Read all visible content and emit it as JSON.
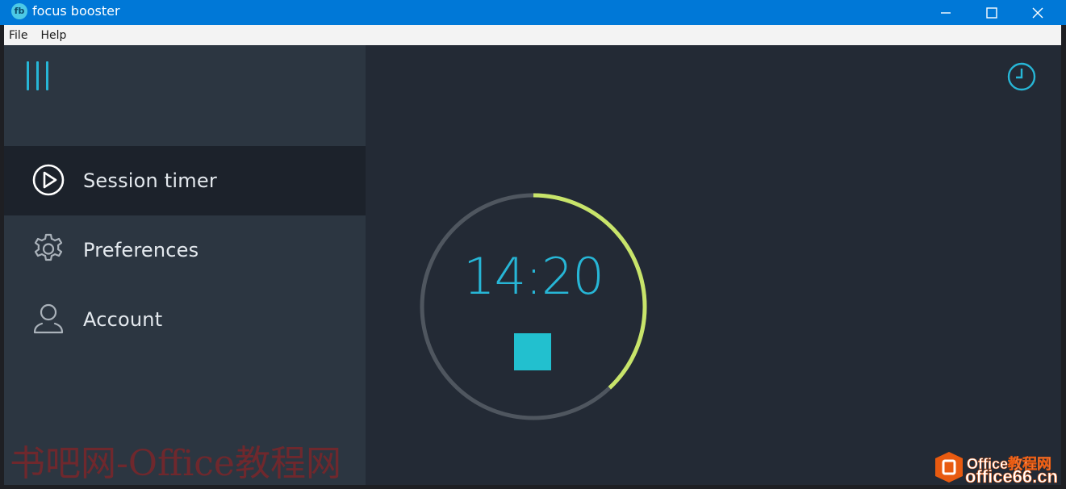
{
  "window": {
    "title": "focus booster",
    "app_icon_text": "fb",
    "controls": [
      "minimize",
      "maximize",
      "close"
    ]
  },
  "menu": {
    "items": [
      "File",
      "Help"
    ]
  },
  "sidebar": {
    "menu_icon": "hamburger-icon",
    "items": [
      {
        "label": "Session timer",
        "icon": "play-circle-icon",
        "active": true
      },
      {
        "label": "Preferences",
        "icon": "gear-icon",
        "active": false
      },
      {
        "label": "Account",
        "icon": "user-icon",
        "active": false
      }
    ]
  },
  "timer": {
    "time": "14:20",
    "progress_fraction": 0.38,
    "progress_color": "#c8e46a",
    "track_color": "#4f565f",
    "accent_color": "#27b6d6",
    "stop_icon": "stop-icon",
    "history_icon": "clock-icon"
  },
  "watermarks": {
    "left": "书吧网-Office教程网",
    "right_top": "Office教程网",
    "right_bottom": "office66.cn"
  }
}
